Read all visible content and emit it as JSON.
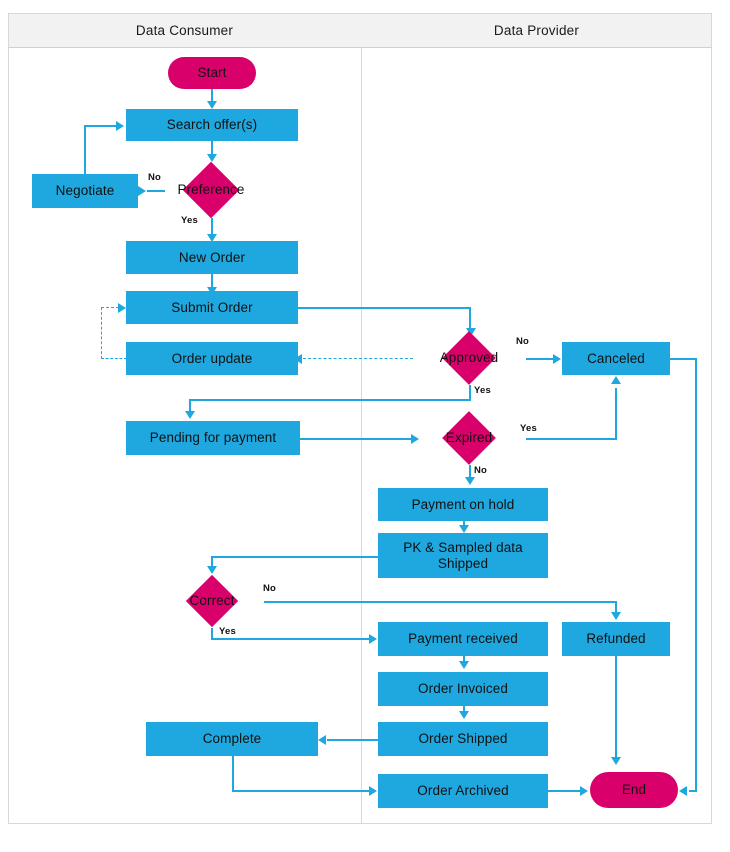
{
  "diagram": {
    "title": "Data marketplace order flow (swimlane flowchart)",
    "colors": {
      "process": "#1fa8df",
      "decision": "#d9006c",
      "terminator": "#d9006c",
      "connector": "#1fa8df",
      "lane_header_bg": "#f2f2f2",
      "lane_border": "#d8d8d8",
      "text": "#111111"
    },
    "lanes": [
      {
        "id": "consumer",
        "label": "Data Consumer"
      },
      {
        "id": "provider",
        "label": "Data Provider"
      }
    ],
    "nodes": {
      "start": {
        "label": "Start",
        "type": "terminator",
        "lane": "consumer"
      },
      "search_offers": {
        "label": "Search offer(s)",
        "type": "process",
        "lane": "consumer"
      },
      "preference": {
        "label": "Preference",
        "type": "decision",
        "lane": "consumer"
      },
      "negotiate": {
        "label": "Negotiate",
        "type": "process",
        "lane": "consumer"
      },
      "new_order": {
        "label": "New Order",
        "type": "process",
        "lane": "consumer"
      },
      "submit_order": {
        "label": "Submit Order",
        "type": "process",
        "lane": "consumer"
      },
      "order_update": {
        "label": "Order update",
        "type": "process",
        "lane": "consumer"
      },
      "approved": {
        "label": "Approved",
        "type": "decision",
        "lane": "provider"
      },
      "canceled": {
        "label": "Canceled",
        "type": "process",
        "lane": "provider"
      },
      "pending_for_payment": {
        "label": "Pending for payment",
        "type": "process",
        "lane": "consumer"
      },
      "expired": {
        "label": "Expired",
        "type": "decision",
        "lane": "provider"
      },
      "payment_on_hold": {
        "label": "Payment on hold",
        "type": "process",
        "lane": "provider"
      },
      "pk_sampled_data_shipped": {
        "label": "PK & Sampled data Shipped",
        "type": "process",
        "lane": "provider"
      },
      "correct": {
        "label": "Correct",
        "type": "decision",
        "lane": "consumer"
      },
      "payment_received": {
        "label": "Payment received",
        "type": "process",
        "lane": "provider"
      },
      "refunded": {
        "label": "Refunded",
        "type": "process",
        "lane": "provider"
      },
      "order_invoiced": {
        "label": "Order Invoiced",
        "type": "process",
        "lane": "provider"
      },
      "order_shipped": {
        "label": "Order Shipped",
        "type": "process",
        "lane": "provider"
      },
      "complete": {
        "label": "Complete",
        "type": "process",
        "lane": "consumer"
      },
      "order_archived": {
        "label": "Order Archived",
        "type": "process",
        "lane": "provider"
      },
      "end": {
        "label": "End",
        "type": "terminator",
        "lane": "provider"
      }
    },
    "edge_labels": {
      "preference_no": "No",
      "preference_yes": "Yes",
      "approved_no": "No",
      "approved_yes": "Yes",
      "expired_yes": "Yes",
      "expired_no": "No",
      "correct_no": "No",
      "correct_yes": "Yes"
    },
    "edges": [
      {
        "from": "start",
        "to": "search_offers",
        "label": ""
      },
      {
        "from": "search_offers",
        "to": "preference",
        "label": ""
      },
      {
        "from": "preference",
        "to": "negotiate",
        "label": "No"
      },
      {
        "from": "negotiate",
        "to": "search_offers",
        "label": ""
      },
      {
        "from": "preference",
        "to": "new_order",
        "label": "Yes"
      },
      {
        "from": "new_order",
        "to": "submit_order",
        "label": ""
      },
      {
        "from": "submit_order",
        "to": "approved",
        "label": ""
      },
      {
        "from": "approved",
        "to": "order_update",
        "label": "",
        "style": "dashed"
      },
      {
        "from": "order_update",
        "to": "submit_order",
        "label": "",
        "style": "dashed"
      },
      {
        "from": "approved",
        "to": "canceled",
        "label": "No"
      },
      {
        "from": "approved",
        "to": "pending_for_payment",
        "label": "Yes"
      },
      {
        "from": "pending_for_payment",
        "to": "expired",
        "label": ""
      },
      {
        "from": "expired",
        "to": "canceled",
        "label": "Yes"
      },
      {
        "from": "expired",
        "to": "payment_on_hold",
        "label": "No"
      },
      {
        "from": "payment_on_hold",
        "to": "pk_sampled_data_shipped",
        "label": ""
      },
      {
        "from": "pk_sampled_data_shipped",
        "to": "correct",
        "label": ""
      },
      {
        "from": "correct",
        "to": "refunded",
        "label": "No"
      },
      {
        "from": "correct",
        "to": "payment_received",
        "label": "Yes"
      },
      {
        "from": "payment_received",
        "to": "order_invoiced",
        "label": ""
      },
      {
        "from": "order_invoiced",
        "to": "order_shipped",
        "label": ""
      },
      {
        "from": "order_shipped",
        "to": "complete",
        "label": ""
      },
      {
        "from": "complete",
        "to": "order_archived",
        "label": ""
      },
      {
        "from": "order_archived",
        "to": "end",
        "label": ""
      },
      {
        "from": "refunded",
        "to": "end",
        "label": ""
      },
      {
        "from": "canceled",
        "to": "end",
        "label": ""
      }
    ]
  }
}
